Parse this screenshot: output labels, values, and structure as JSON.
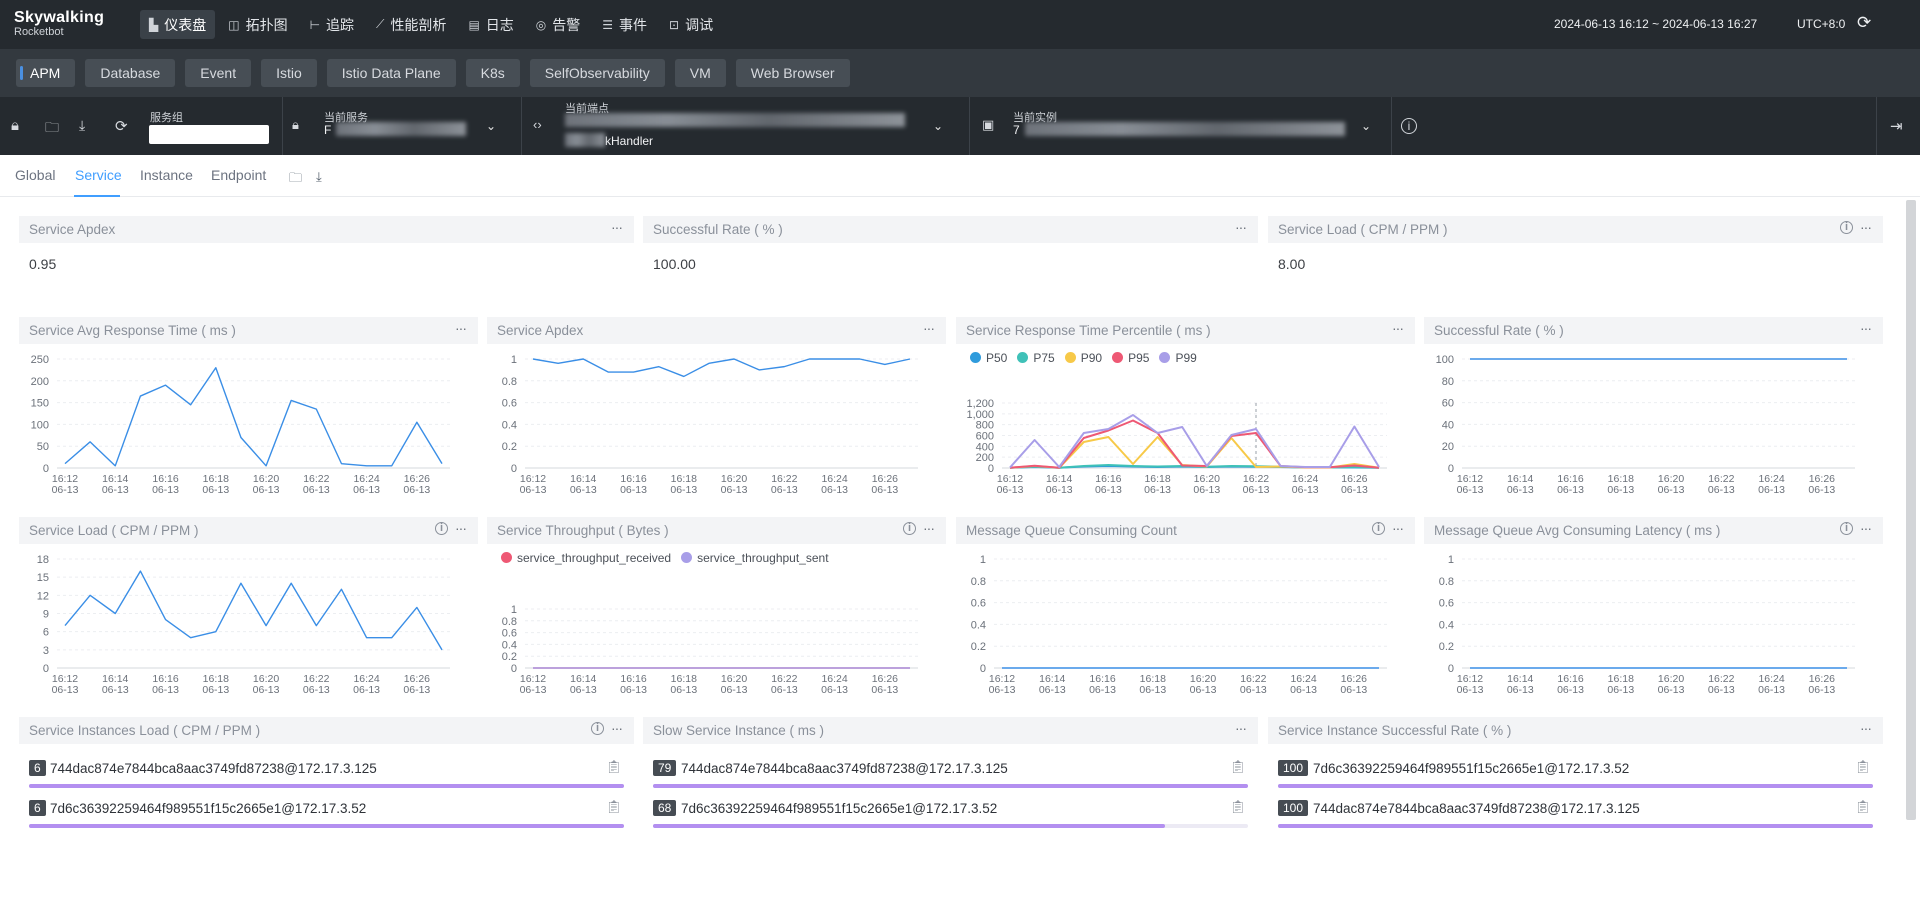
{
  "brand": {
    "name": "Skywalking",
    "sub": "Rocketbot"
  },
  "nav": [
    {
      "icon": "dashboard-icon",
      "glyph": "▙",
      "label": "仪表盘",
      "active": true
    },
    {
      "icon": "topology-icon",
      "glyph": "◫",
      "label": "拓扑图"
    },
    {
      "icon": "trace-icon",
      "glyph": "⊢",
      "label": "追踪"
    },
    {
      "icon": "profiling-icon",
      "glyph": "⟋",
      "label": "性能剖析"
    },
    {
      "icon": "log-icon",
      "glyph": "▤",
      "label": "日志"
    },
    {
      "icon": "alarm-icon",
      "glyph": "◎",
      "label": "告警"
    },
    {
      "icon": "event-icon",
      "glyph": "☰",
      "label": "事件"
    },
    {
      "icon": "debug-icon",
      "glyph": "⊡",
      "label": "调试"
    }
  ],
  "time_range": "2024-06-13 16:12 ~ 2024-06-13 16:27",
  "timezone": "UTC+8:0",
  "layers": [
    "APM",
    "Database",
    "Event",
    "Istio",
    "Istio Data Plane",
    "K8s",
    "SelfObservability",
    "VM",
    "Web Browser"
  ],
  "selectors": {
    "group_label": "服务组",
    "group_value": "",
    "service_label": "当前服务",
    "service_value": "F",
    "endpoint_label": "当前端点",
    "endpoint_value": "kHandler",
    "instance_label": "当前实例",
    "instance_value": "7"
  },
  "tabs": [
    "Global",
    "Service",
    "Instance",
    "Endpoint"
  ],
  "active_tab": "Service",
  "cards": [
    {
      "title": "Service Apdex",
      "value": "0.95"
    },
    {
      "title": "Successful Rate ( % )",
      "value": "100.00"
    },
    {
      "title": "Service Load ( CPM / PPM )",
      "value": "8.00"
    }
  ],
  "x_ticks": [
    [
      "16:12",
      "06-13"
    ],
    [
      "16:14",
      "06-13"
    ],
    [
      "16:16",
      "06-13"
    ],
    [
      "16:18",
      "06-13"
    ],
    [
      "16:20",
      "06-13"
    ],
    [
      "16:22",
      "06-13"
    ],
    [
      "16:24",
      "06-13"
    ],
    [
      "16:26",
      "06-13"
    ]
  ],
  "chart_data": [
    {
      "id": "avg-response-time",
      "type": "line",
      "title": "Service Avg Response Time ( ms )",
      "y_ticks": [
        "0",
        "50",
        "100",
        "150",
        "200",
        "250"
      ],
      "ylim": [
        0,
        250
      ],
      "series": [
        {
          "color": "#3a8ee6",
          "values": [
            10,
            60,
            5,
            165,
            190,
            145,
            230,
            70,
            5,
            155,
            135,
            10,
            5,
            5,
            105,
            10
          ]
        }
      ]
    },
    {
      "id": "service-apdex",
      "type": "line",
      "title": "Service Apdex",
      "y_ticks": [
        "0",
        "0.2",
        "0.4",
        "0.6",
        "0.8",
        "1"
      ],
      "ylim": [
        0,
        1
      ],
      "series": [
        {
          "color": "#3a8ee6",
          "values": [
            1,
            0.96,
            1,
            0.88,
            0.88,
            0.93,
            0.84,
            0.96,
            1,
            0.9,
            0.93,
            1,
            1,
            1,
            0.95,
            1
          ]
        }
      ]
    },
    {
      "id": "response-percentile",
      "type": "line",
      "title": "Service Response Time Percentile ( ms )",
      "y_ticks": [
        "0",
        "200",
        "400",
        "600",
        "800",
        "1,000",
        "1,200"
      ],
      "ylim": [
        0,
        1300
      ],
      "legend": [
        "P50",
        "P75",
        "P90",
        "P95",
        "P99"
      ],
      "series": [
        {
          "name": "P50",
          "color": "#2f9bdc",
          "values": [
            5,
            20,
            5,
            30,
            40,
            30,
            20,
            30,
            20,
            30,
            25,
            20,
            10,
            10,
            10,
            5
          ]
        },
        {
          "name": "P75",
          "color": "#3fc1b8",
          "values": [
            5,
            30,
            5,
            40,
            60,
            40,
            30,
            40,
            25,
            40,
            35,
            25,
            10,
            10,
            20,
            5
          ]
        },
        {
          "name": "P90",
          "color": "#f7c948",
          "values": [
            5,
            40,
            5,
            520,
            620,
            80,
            620,
            60,
            30,
            600,
            20,
            30,
            10,
            10,
            80,
            5
          ]
        },
        {
          "name": "P95",
          "color": "#ee5874",
          "values": [
            5,
            45,
            5,
            600,
            750,
            950,
            700,
            50,
            40,
            640,
            700,
            40,
            15,
            15,
            50,
            5
          ]
        },
        {
          "name": "P99",
          "color": "#a89ee8",
          "values": [
            10,
            560,
            20,
            700,
            780,
            1060,
            700,
            820,
            40,
            660,
            780,
            40,
            20,
            20,
            830,
            20
          ]
        }
      ]
    },
    {
      "id": "successful-rate",
      "type": "line",
      "title": "Successful Rate ( % )",
      "y_ticks": [
        "0",
        "20",
        "40",
        "60",
        "80",
        "100"
      ],
      "ylim": [
        0,
        100
      ],
      "series": [
        {
          "color": "#3a8ee6",
          "values": [
            100,
            100,
            100,
            100,
            100,
            100,
            100,
            100,
            100,
            100,
            100,
            100,
            100,
            100,
            100,
            100
          ]
        }
      ]
    },
    {
      "id": "service-load",
      "type": "line",
      "title": "Service Load ( CPM / PPM )",
      "y_ticks": [
        "0",
        "3",
        "6",
        "9",
        "12",
        "15",
        "18"
      ],
      "ylim": [
        0,
        18
      ],
      "series": [
        {
          "color": "#3a8ee6",
          "values": [
            7,
            12,
            9,
            16,
            8,
            5,
            6,
            14,
            7,
            14,
            7,
            13,
            5,
            5,
            10,
            3
          ]
        }
      ]
    },
    {
      "id": "throughput",
      "type": "line",
      "title": "Service Throughput ( Bytes )",
      "y_ticks": [
        "0",
        "0.2",
        "0.4",
        "0.6",
        "0.8",
        "1"
      ],
      "ylim": [
        0,
        1
      ],
      "legend": [
        "service_throughput_received",
        "service_throughput_sent"
      ],
      "series": [
        {
          "name": "service_throughput_received",
          "color": "#ee5874",
          "values": [
            0,
            0,
            0,
            0,
            0,
            0,
            0,
            0,
            0,
            0,
            0,
            0,
            0,
            0,
            0,
            0
          ]
        },
        {
          "name": "service_throughput_sent",
          "color": "#a89ee8",
          "values": [
            0,
            0,
            0,
            0,
            0,
            0,
            0,
            0,
            0,
            0,
            0,
            0,
            0,
            0,
            0,
            0
          ]
        }
      ]
    },
    {
      "id": "mq-count",
      "type": "line",
      "title": "Message Queue Consuming Count",
      "y_ticks": [
        "0",
        "0.2",
        "0.4",
        "0.6",
        "0.8",
        "1"
      ],
      "ylim": [
        0,
        1
      ],
      "series": [
        {
          "color": "#3a8ee6",
          "values": [
            0,
            0,
            0,
            0,
            0,
            0,
            0,
            0,
            0,
            0,
            0,
            0,
            0,
            0,
            0,
            0
          ]
        }
      ]
    },
    {
      "id": "mq-latency",
      "type": "line",
      "title": "Message Queue Avg Consuming Latency ( ms )",
      "y_ticks": [
        "0",
        "0.2",
        "0.4",
        "0.6",
        "0.8",
        "1"
      ],
      "ylim": [
        0,
        1
      ],
      "series": [
        {
          "color": "#3a8ee6",
          "values": [
            0,
            0,
            0,
            0,
            0,
            0,
            0,
            0,
            0,
            0,
            0,
            0,
            0,
            0,
            0,
            0
          ]
        }
      ]
    }
  ],
  "lists": [
    {
      "title": "Service Instances Load ( CPM / PPM )",
      "rows": [
        {
          "badge": "6",
          "name": "744dac874e7844bca8aac3749fd87238@172.17.3.125",
          "fill": 1.0
        },
        {
          "badge": "6",
          "name": "7d6c36392259464f989551f15c2665e1@172.17.3.52",
          "fill": 1.0
        }
      ]
    },
    {
      "title": "Slow Service Instance ( ms )",
      "rows": [
        {
          "badge": "79",
          "name": "744dac874e7844bca8aac3749fd87238@172.17.3.125",
          "fill": 1.0
        },
        {
          "badge": "68",
          "name": "7d6c36392259464f989551f15c2665e1@172.17.3.52",
          "fill": 0.86
        }
      ]
    },
    {
      "title": "Service Instance Successful Rate ( % )",
      "rows": [
        {
          "badge": "100",
          "name": "7d6c36392259464f989551f15c2665e1@172.17.3.52",
          "fill": 1.0
        },
        {
          "badge": "100",
          "name": "744dac874e7844bca8aac3749fd87238@172.17.3.125",
          "fill": 1.0
        }
      ]
    }
  ]
}
